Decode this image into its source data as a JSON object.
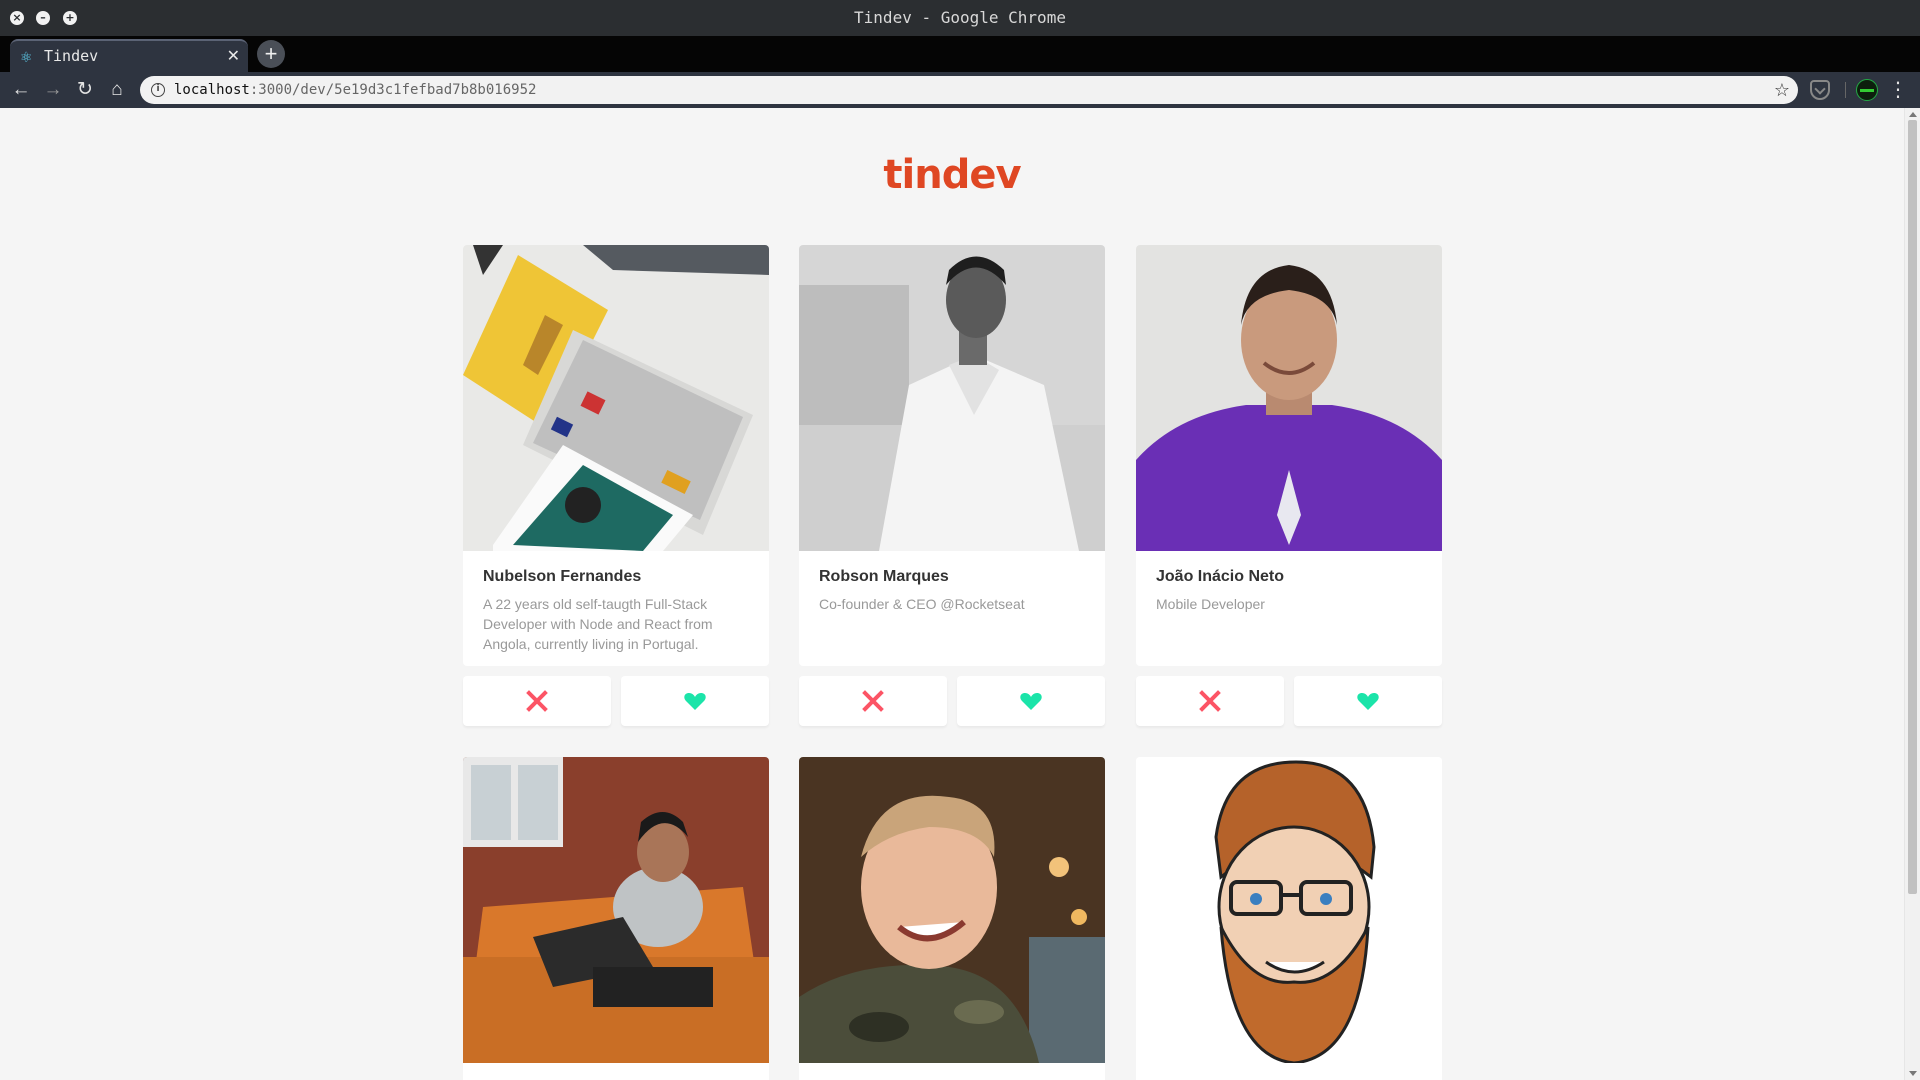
{
  "window": {
    "title": "Tindev - Google Chrome"
  },
  "tab": {
    "title": "Tindev",
    "close_glyph": "✕",
    "favicon": "react-icon"
  },
  "toolbar": {
    "url_host": "localhost",
    "url_path": ":3000/dev/5e19d3c1fefbad7b8b016952",
    "back_glyph": "←",
    "forward_glyph": "→",
    "reload_glyph": "↻",
    "home_glyph": "⌂",
    "star_glyph": "☆",
    "menu_glyph": "⋮",
    "newtab_glyph": "+"
  },
  "app": {
    "logo": "tindev"
  },
  "colors": {
    "brand": "#df4723",
    "dislike": "#fc5465",
    "like": "#1be4a9",
    "page_bg": "#f5f5f5"
  },
  "devs": [
    {
      "name": "Nubelson Fernandes",
      "bio": "A 22 years old self-taugth Full-Stack Developer with Node and React from Angola, currently living in Portugal.",
      "photo": "keyboard-books-photo"
    },
    {
      "name": "Robson Marques",
      "bio": "Co-founder & CEO @Rocketseat",
      "photo": "man-white-shirt-photo"
    },
    {
      "name": "João Inácio Neto",
      "bio": "Mobile Developer",
      "photo": "man-purple-shirt-photo"
    },
    {
      "name": "",
      "bio": "",
      "photo": "man-laptop-sofa-photo"
    },
    {
      "name": "",
      "bio": "",
      "photo": "man-smiling-camo-photo"
    },
    {
      "name": "",
      "bio": "",
      "photo": "bearded-man-caricature"
    }
  ]
}
